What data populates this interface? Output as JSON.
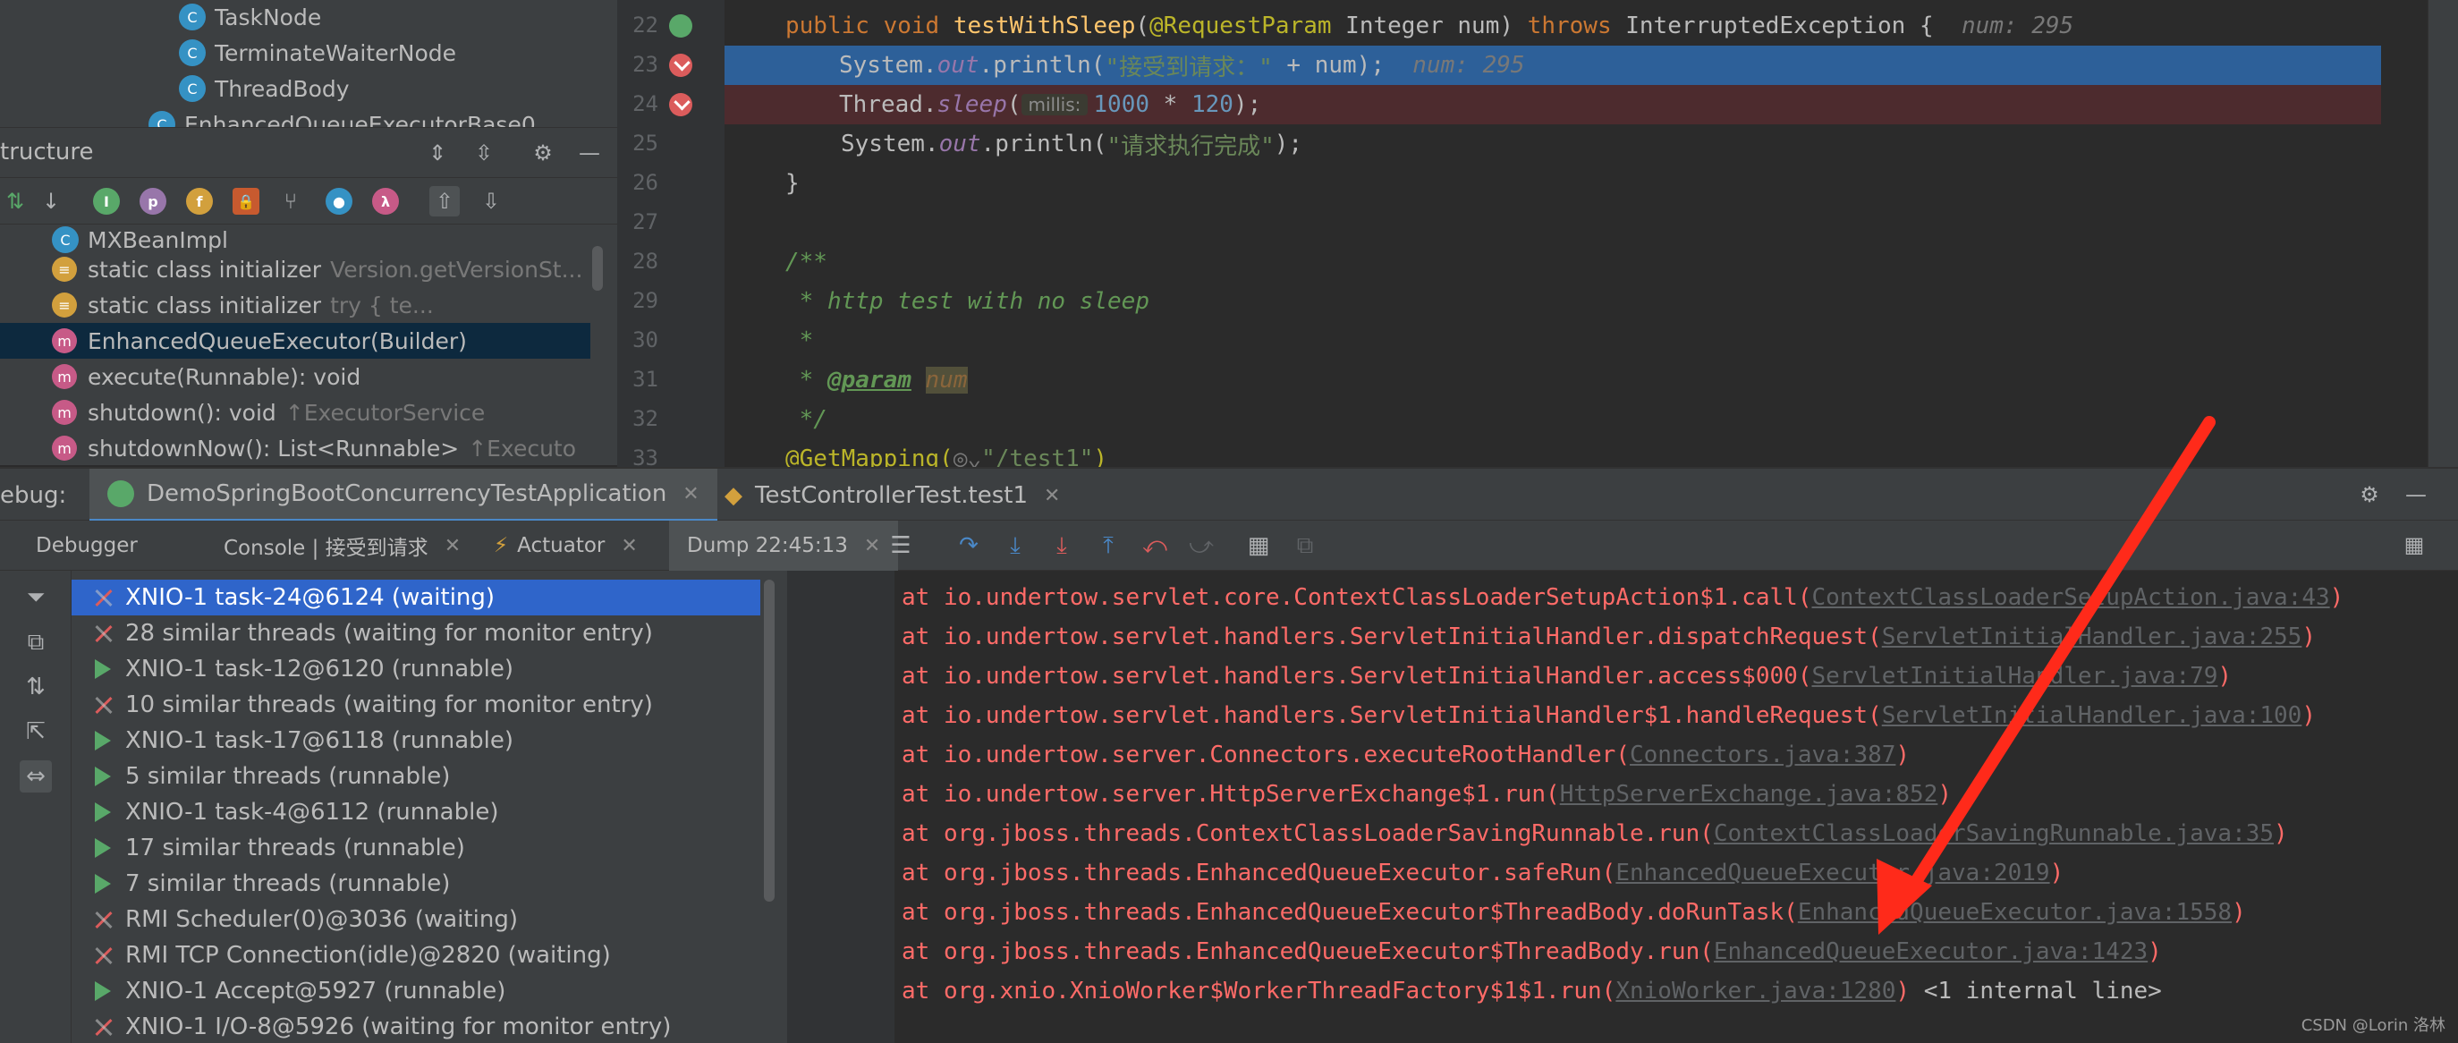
{
  "project_tree": {
    "items": [
      {
        "label": "TaskNode"
      },
      {
        "label": "TerminateWaiterNode"
      },
      {
        "label": "ThreadBody"
      },
      {
        "label": "EnhancedQueueExecutorBase0"
      }
    ]
  },
  "structure": {
    "title": "tructure",
    "toolbar_pills": [
      "I",
      "p",
      "f",
      "🔒",
      "λ"
    ],
    "items": [
      {
        "label": "MXBeanImpl",
        "hint": ""
      },
      {
        "label": "static class initializer",
        "hint": "Version.getVersionSt..."
      },
      {
        "label": "static class initializer",
        "hint": "try {            te..."
      },
      {
        "label": "EnhancedQueueExecutor(Builder)",
        "hint": ""
      },
      {
        "label": "execute(Runnable): void",
        "hint": ""
      },
      {
        "label": "shutdown(): void",
        "hint": "↑ExecutorService"
      },
      {
        "label": "shutdownNow(): List<Runnable>",
        "hint": "↑Executo"
      }
    ]
  },
  "editor": {
    "line_numbers": [
      "22",
      "23",
      "24",
      "25",
      "26",
      "27",
      "28",
      "29",
      "30",
      "31",
      "32",
      "33"
    ],
    "line22": {
      "public": "public",
      "void": "void",
      "method": "testWithSleep",
      "annotation": "@RequestParam",
      "type": "Integer num",
      "throws": "throws",
      "exception": "InterruptedException {",
      "inline": "num: 295"
    },
    "line23": {
      "prefix": "System.",
      "out": "out",
      "println": ".println(",
      "string": "\"接受到请求：\"",
      "rest": " + num);",
      "inline": "num: 295"
    },
    "line24": {
      "prefix": "Thread.",
      "sleep": "sleep",
      "paren": "(",
      "param_hint": "millis:",
      "num1": "1000",
      "op": " * ",
      "num2": "120",
      "end": ");"
    },
    "line25": {
      "prefix": "System.",
      "out": "out",
      "println": ".println(",
      "string": "\"请求执行完成\"",
      "end": ");"
    },
    "line26": "}",
    "line28": "/**",
    "line29": " * http test with no sleep",
    "line30": " *",
    "line31": {
      "star": " * ",
      "tag": "@param",
      "name": "num"
    },
    "line32": " */",
    "line33": {
      "annotation": "@GetMapping(",
      "str": "\"/test1\"",
      "end": ")"
    }
  },
  "debug": {
    "label": "ebug:",
    "tabs": [
      {
        "label": "DemoSpringBootConcurrencyTestApplication"
      },
      {
        "label": "TestControllerTest.test1"
      }
    ],
    "subtabs": [
      {
        "label": "Debugger"
      },
      {
        "label": "Console | 接受到请求"
      },
      {
        "label": "Actuator"
      },
      {
        "label": "Dump 22:45:13"
      }
    ]
  },
  "threads": [
    {
      "label": "XNIO-1 task-24@6124 (waiting)",
      "state": "wait"
    },
    {
      "label": "28 similar threads (waiting for monitor entry)",
      "state": "wait"
    },
    {
      "label": "XNIO-1 task-12@6120 (runnable)",
      "state": "run"
    },
    {
      "label": "10 similar threads (waiting for monitor entry)",
      "state": "wait"
    },
    {
      "label": "XNIO-1 task-17@6118 (runnable)",
      "state": "run"
    },
    {
      "label": "5 similar threads (runnable)",
      "state": "run"
    },
    {
      "label": "XNIO-1 task-4@6112 (runnable)",
      "state": "run"
    },
    {
      "label": "17 similar threads (runnable)",
      "state": "run"
    },
    {
      "label": "7 similar threads (runnable)",
      "state": "run"
    },
    {
      "label": "RMI Scheduler(0)@3036 (waiting)",
      "state": "wait"
    },
    {
      "label": "RMI TCP Connection(idle)@2820 (waiting)",
      "state": "wait"
    },
    {
      "label": "XNIO-1 Accept@5927 (runnable)",
      "state": "run"
    },
    {
      "label": "XNIO-1 I/O-8@5926 (waiting for monitor entry)",
      "state": "wait"
    }
  ],
  "stack_trace": [
    {
      "text": "at io.undertow.servlet.core.ContextClassLoaderSetupAction$1.call(",
      "link": "ContextClassLoaderSetupAction.java:43",
      "end": ")"
    },
    {
      "text": "at io.undertow.servlet.handlers.ServletInitialHandler.dispatchRequest(",
      "link": "ServletInitialHandler.java:255",
      "end": ")"
    },
    {
      "text": "at io.undertow.servlet.handlers.ServletInitialHandler.access$000(",
      "link": "ServletInitialHandler.java:79",
      "end": ")"
    },
    {
      "text": "at io.undertow.servlet.handlers.ServletInitialHandler$1.handleRequest(",
      "link": "ServletInitialHandler.java:100",
      "end": ")"
    },
    {
      "text": "at io.undertow.server.Connectors.executeRootHandler(",
      "link": "Connectors.java:387",
      "end": ")"
    },
    {
      "text": "at io.undertow.server.HttpServerExchange$1.run(",
      "link": "HttpServerExchange.java:852",
      "end": ")"
    },
    {
      "text": "at org.jboss.threads.ContextClassLoaderSavingRunnable.run(",
      "link": "ContextClassLoaderSavingRunnable.java:35",
      "end": ")"
    },
    {
      "text": "at org.jboss.threads.EnhancedQueueExecutor.safeRun(",
      "link": "EnhancedQueueExecutor.java:2019",
      "end": ")"
    },
    {
      "text": "at org.jboss.threads.EnhancedQueueExecutor$ThreadBody.doRunTask(",
      "link": "EnhancedQueueExecutor.java:1558",
      "end": ")"
    },
    {
      "text": "at org.jboss.threads.EnhancedQueueExecutor$ThreadBody.run(",
      "link": "EnhancedQueueExecutor.java:1423",
      "end": ")"
    },
    {
      "text": "at org.xnio.XnioWorker$WorkerThreadFactory$1$1.run(",
      "link": "XnioWorker.java:1280",
      "end": ")",
      "internal": " <1 internal line>"
    }
  ],
  "watermark": "CSDN @Lorin 洛林",
  "colors": {
    "accent": "#2f65ca",
    "arrow": "#ff2a1a",
    "trace": "#ff6b68"
  }
}
